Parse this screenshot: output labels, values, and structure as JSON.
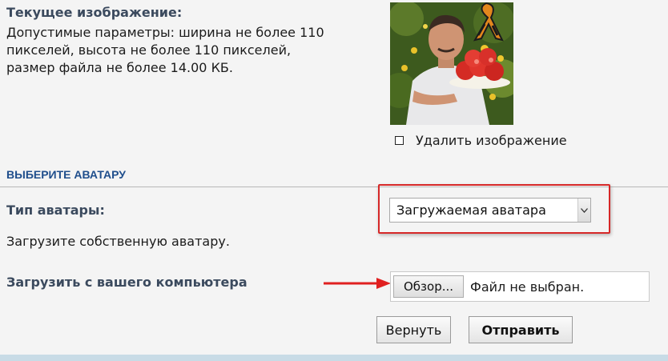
{
  "current_image": {
    "title": "Текущее изображение:",
    "lines": [
      "Допустимые параметры: ширина не более 110",
      "пикселей, высота не более 110 пикселей,",
      "размер файла не более 14.00 КБ."
    ],
    "delete_label": "Удалить изображение",
    "delete_checked": false
  },
  "avatar_section": {
    "title": "ВЫБЕРИТЕ АВАТАРУ",
    "type_label": "Тип аватары:",
    "type_selected": "Загружаемая аватара",
    "upload_hint": "Загрузите собственную аватару.",
    "upload_label": "Загрузить с вашего компьютера"
  },
  "file_input": {
    "browse_label": "Обзор...",
    "status": "Файл не выбран."
  },
  "buttons": {
    "reset": "Вернуть",
    "submit": "Отправить"
  },
  "colors": {
    "highlight": "#d62828",
    "section_title": "#1f4e8c",
    "label": "#3b4a5e",
    "background": "#f4f4f4",
    "footer": "#c8dbe6"
  },
  "icons": {
    "arrow": "red-arrow-right-icon",
    "ribbon": "st-george-ribbon-icon",
    "select": "chevron-down-icon"
  }
}
